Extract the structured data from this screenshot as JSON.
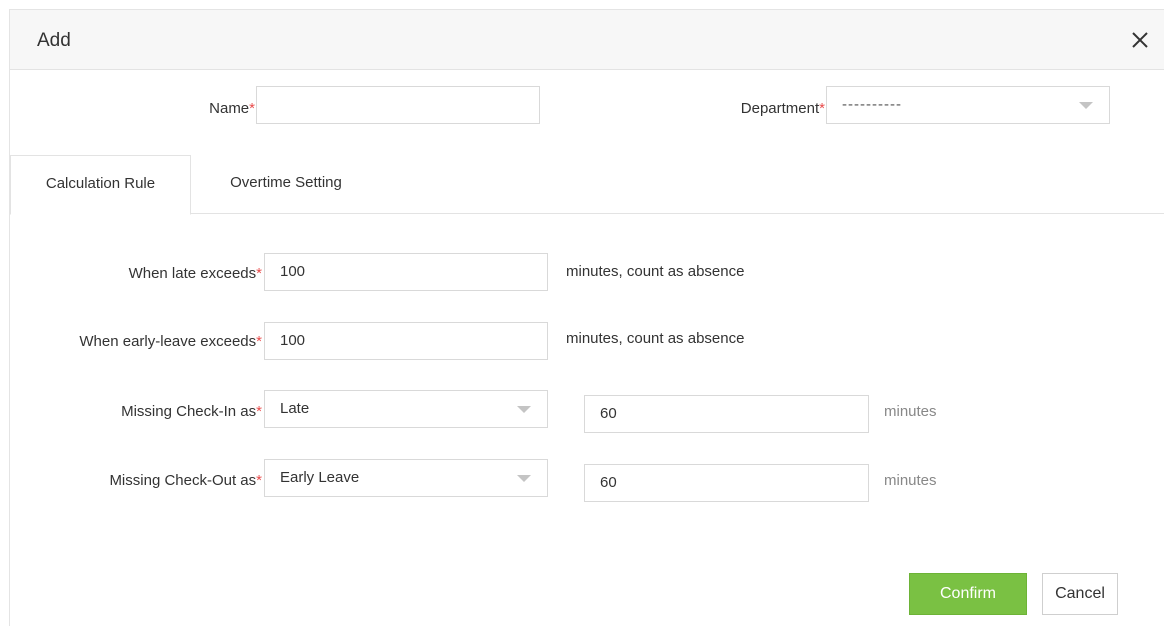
{
  "dialog": {
    "title": "Add",
    "close_icon": "close-icon"
  },
  "form": {
    "name_label": "Name",
    "name_value": "",
    "department_label": "Department",
    "department_value": "----------",
    "required_mark": "*"
  },
  "tabs": [
    {
      "label": "Calculation Rule",
      "active": true
    },
    {
      "label": "Overtime Setting",
      "active": false
    }
  ],
  "rules": {
    "late_label": "When late exceeds",
    "late_value": "100",
    "late_suffix": "minutes, count as absence",
    "early_label": "When early-leave exceeds",
    "early_value": "100",
    "early_suffix": "minutes, count as absence",
    "missing_in_label": "Missing Check-In as",
    "missing_in_select": "Late",
    "missing_in_minutes": "60",
    "missing_in_unit": "minutes",
    "missing_out_label": "Missing Check-Out as",
    "missing_out_select": "Early Leave",
    "missing_out_minutes": "60",
    "missing_out_unit": "minutes"
  },
  "footer": {
    "confirm_label": "Confirm",
    "cancel_label": "Cancel"
  },
  "colors": {
    "primary": "#7ac143",
    "required": "#e94b4b",
    "header_bg": "#f7f7f7"
  }
}
